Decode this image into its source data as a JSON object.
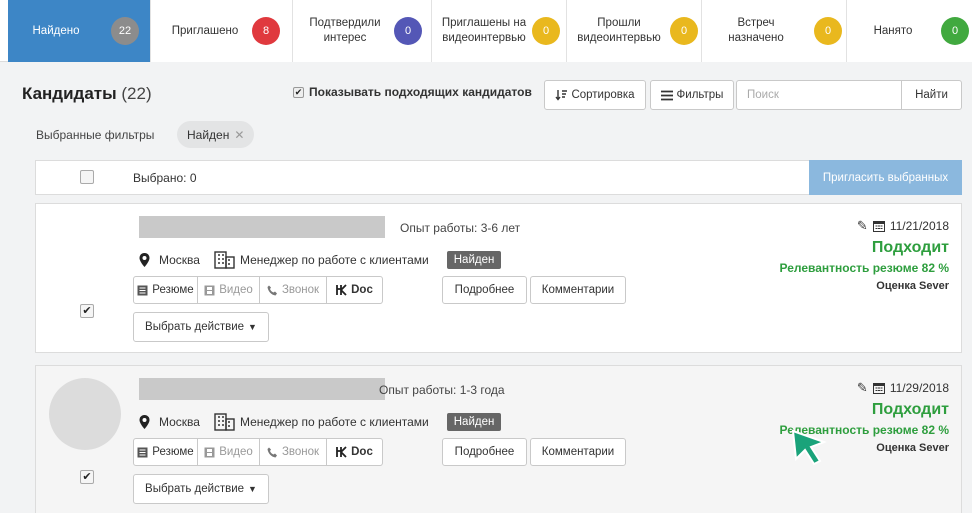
{
  "tabs": [
    {
      "label": "Найдено",
      "count": "22",
      "color": "#8c8c8c",
      "active": true
    },
    {
      "label": "Приглашено",
      "count": "8",
      "color": "#e0393e"
    },
    {
      "label": "Подтвердили\nинтерес",
      "count": "0",
      "color": "#5457b6"
    },
    {
      "label": "Приглашены на\nвидеоинтервью",
      "count": "0",
      "color": "#e9b81e"
    },
    {
      "label": "Прошли\nвидеоинтервью",
      "count": "0",
      "color": "#e9b81e"
    },
    {
      "label": "Встреч\nназначено",
      "count": "0",
      "color": "#e9b81e"
    },
    {
      "label": "Нанято",
      "count": "0",
      "color": "#41a93f"
    }
  ],
  "header": {
    "title": "Кандидаты",
    "count": "(22)",
    "show_matching": "Показывать подходящих кандидатов",
    "sort_label": "Сортировка",
    "filters_label": "Фильтры",
    "search_placeholder": "Поиск",
    "search_button": "Найти"
  },
  "filters": {
    "label": "Выбранные фильтры",
    "chip": "Найден"
  },
  "selection": {
    "selected_text": "Выбрано: 0",
    "invite_button": "Пригласить выбранных"
  },
  "candidates": [
    {
      "experience": "Опыт работы: 3-6 лет",
      "city": "Москва",
      "position": "Менеджер по работе с клиентами",
      "status": "Найден",
      "date": "11/21/2018",
      "fit": "Подходит",
      "relevance": "Релевантность резюме 82 %",
      "score": "Оценка Sever"
    },
    {
      "experience": "Опыт работы: 1-3 года",
      "city": "Москва",
      "position": "Менеджер по работе с клиентами",
      "status": "Найден",
      "date": "11/29/2018",
      "fit": "Подходит",
      "relevance": "Релевантность резюме 82 %",
      "score": "Оценка Sever"
    }
  ],
  "card_actions": {
    "resume": "Резюме",
    "video": "Видео",
    "call": "Звонок",
    "doc": "Doc",
    "details": "Подробнее",
    "comments": "Комментарии",
    "choose_action": "Выбрать действие"
  },
  "colors": {
    "active_tab": "#3d86c6",
    "fit_green": "#2e9e3e",
    "cursor": "#1aa37a"
  }
}
